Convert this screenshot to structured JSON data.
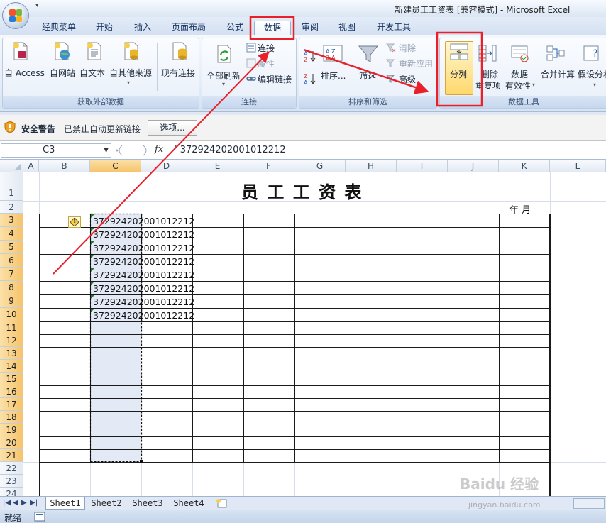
{
  "window": {
    "title": "新建员工工资表  [兼容模式] - Microsoft Excel",
    "qat_dropdown": "▾"
  },
  "tabs": [
    "经典菜单",
    "开始",
    "插入",
    "页面布局",
    "公式",
    "数据",
    "审阅",
    "视图",
    "开发工具"
  ],
  "active_tab": "数据",
  "ribbon": {
    "get_external": {
      "label": "获取外部数据",
      "buttons": [
        "自 Access",
        "自网站",
        "自文本",
        "自其他来源",
        "现有连接"
      ]
    },
    "connections": {
      "label": "连接",
      "refresh_all": "全部刷新",
      "connections": "连接",
      "properties": "属性",
      "edit_links": "编辑链接"
    },
    "sort_filter": {
      "label": "排序和筛选",
      "sort": "排序...",
      "filter": "筛选",
      "clear": "清除",
      "reapply": "重新应用",
      "advanced": "高级"
    },
    "data_tools": {
      "label": "数据工具",
      "split": "分列",
      "remove_dup_1": "删除",
      "remove_dup_2": "重复项",
      "validation_1": "数据",
      "validation_2": "有效性",
      "consolidate": "合并计算",
      "whatif": "假设分析"
    }
  },
  "security": {
    "title": "安全警告",
    "message": "已禁止自动更新链接",
    "options": "选项..."
  },
  "formula_bar": {
    "name_box": "C3",
    "fx": "fx",
    "formula": "' 372924202001012212"
  },
  "sheet": {
    "columns": [
      "A",
      "B",
      "C",
      "D",
      "E",
      "F",
      "G",
      "H",
      "I",
      "J",
      "K",
      "L"
    ],
    "rows": [
      "1",
      "2",
      "3",
      "4",
      "5",
      "6",
      "7",
      "8",
      "9",
      "10",
      "11",
      "12",
      "13",
      "14",
      "15",
      "16",
      "17",
      "18",
      "19",
      "20",
      "21",
      "22",
      "23",
      "24"
    ],
    "title": "员 工 工 资 表",
    "year_month": "年    月",
    "id_values": [
      "372924202001012212",
      "372924202001012212",
      "372924202001012212",
      "372924202001012212",
      "372924202001012212",
      "372924202001012212",
      "372924202001012212",
      "372924202001012212"
    ],
    "warning_glyph": "!"
  },
  "sheet_tabs": [
    "Sheet1",
    "Sheet2",
    "Sheet3",
    "Sheet4"
  ],
  "active_sheet": "Sheet1",
  "status": {
    "text": "就绪"
  },
  "watermark": {
    "brand": "Baidu 经验",
    "url": "jingyan.baidu.com"
  },
  "colors": {
    "highlight_red": "#e8202a",
    "selection_fill": "#e4eaf5",
    "header_selected": "#f6c46b"
  }
}
